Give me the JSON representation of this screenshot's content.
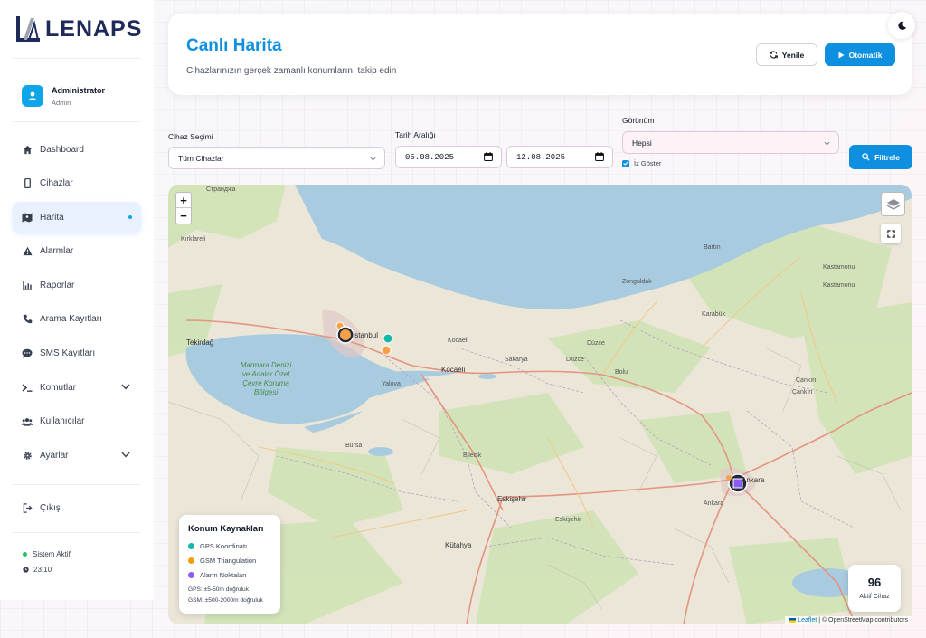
{
  "brand": {
    "name": "LENAPS"
  },
  "user": {
    "name": "Administrator",
    "role": "Admin"
  },
  "nav": {
    "items": [
      {
        "label": "Dashboard",
        "icon": "home-icon"
      },
      {
        "label": "Cihazlar",
        "icon": "phone-icon"
      },
      {
        "label": "Harita",
        "icon": "map-icon",
        "active": true
      },
      {
        "label": "Alarmlar",
        "icon": "warning-icon"
      },
      {
        "label": "Raporlar",
        "icon": "chart-icon"
      },
      {
        "label": "Arama Kayıtları",
        "icon": "call-icon"
      },
      {
        "label": "SMS Kayıtları",
        "icon": "sms-icon"
      },
      {
        "label": "Komutlar",
        "icon": "terminal-icon",
        "expandable": true
      },
      {
        "label": "Kullanıcılar",
        "icon": "users-icon"
      },
      {
        "label": "Ayarlar",
        "icon": "gear-icon",
        "expandable": true
      }
    ],
    "logout": "Çıkış"
  },
  "system": {
    "status": "Sistem Aktif",
    "time": "23:10",
    "status_color": "#22c55e"
  },
  "header": {
    "title": "Canlı Harita",
    "subtitle": "Cihazlarınızın gerçek zamanlı konumlarını takip edin",
    "refresh_label": "Yenile",
    "auto_label": "Otomatik"
  },
  "filters": {
    "device": {
      "label": "Cihaz Seçimi",
      "value": "Tüm Cihazlar"
    },
    "date": {
      "label": "Tarih Aralığı",
      "start": "05.08.2025",
      "end": "12.08.2025"
    },
    "view": {
      "label": "Görünüm",
      "value": "Hepsi"
    },
    "trace": {
      "label": "İz Göster",
      "checked": true
    },
    "filter_label": "Filtrele"
  },
  "map": {
    "labels": {
      "kirklareli": "Kırklareli",
      "tekirdag": "Tekirdağ",
      "istanbul": "İstanbul",
      "kocaeli": "Kocaeli",
      "kocaeli2": "Kocaeli",
      "duzce": "Düzce",
      "duzce2": "Düzce",
      "bolu": "Bolu",
      "sakarya": "Sakarya",
      "yalova": "Yalova",
      "bursa": "Bursa",
      "bilecik": "Bilecik",
      "eskisehir": "Eskişehir",
      "eskisehir2": "Eskişehir",
      "kutahya": "Kütahya",
      "ankara": "Ankara",
      "ankara2": "Ankara",
      "cankiri": "Çankırı",
      "cankiri2": "Çankırı",
      "kastamonu": "Kastamonu",
      "kastamonu2": "Kastamonu",
      "zonguldak": "Zonguldak",
      "bartin": "Bartın",
      "karabuk": "Karabük",
      "strandzha": "Странджа",
      "sea": "Marmara Denizi ve Adalar Özel Çevre Koruma Bölgesi"
    },
    "legend": {
      "title": "Konum Kaynakları",
      "items": [
        {
          "label": "GPS Koordinatı",
          "color": "#14b8a6"
        },
        {
          "label": "GSM Triangulation",
          "color": "#f59e0b"
        },
        {
          "label": "Alarm Noktaları",
          "color": "#8b5cf6"
        }
      ],
      "note_gps": "GPS: ±5-50m doğruluk",
      "note_gsm": "GSM: ±500-2000m doğruluk"
    },
    "active": {
      "count": "96",
      "label": "Aktif Cihaz"
    },
    "attribution": {
      "leaflet": "Leaflet",
      "osm": "| © OpenStreetMap contributors"
    },
    "zoom_in": "+",
    "zoom_out": "−"
  },
  "colors": {
    "accent": "#0e8fe0",
    "active_bg": "#e8f1fd"
  }
}
